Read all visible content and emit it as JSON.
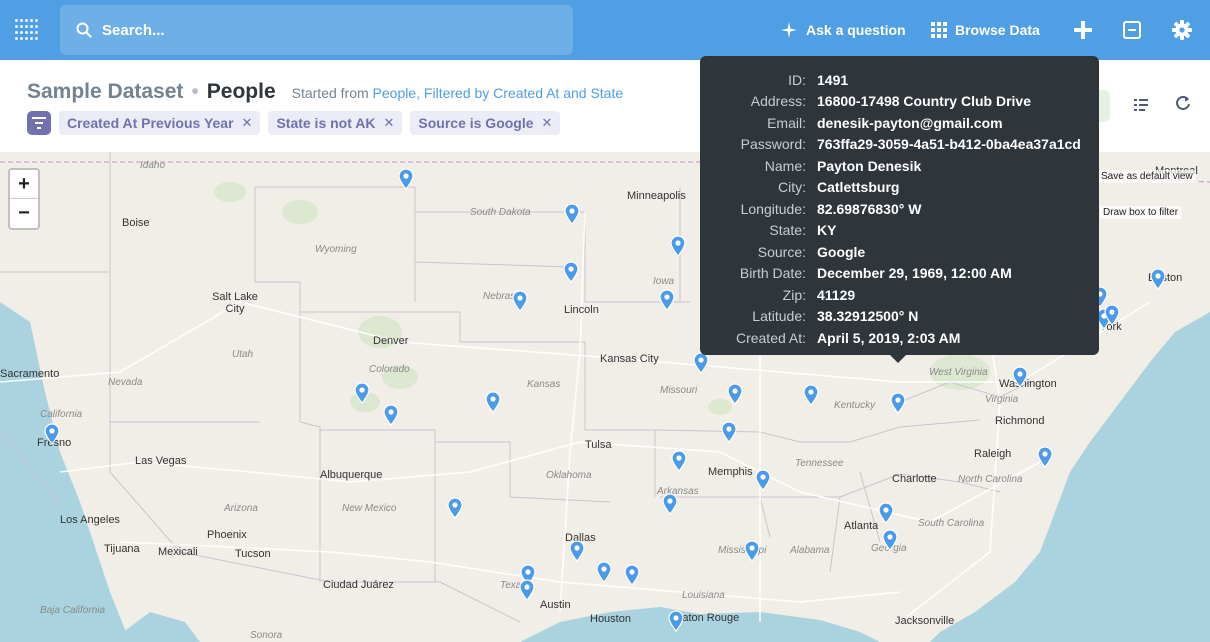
{
  "nav": {
    "search_placeholder": "Search...",
    "ask_label": "Ask a question",
    "browse_label": "Browse Data",
    "brand_color": "#509ee3"
  },
  "header": {
    "database": "Sample Dataset",
    "separator": "•",
    "table": "People",
    "started_from_prefix": "Started from",
    "started_from_link": "People, Filtered by Created At and State",
    "filters": [
      {
        "label": "Created At Previous Year"
      },
      {
        "label": "State is not AK"
      },
      {
        "label": "Source is Google"
      }
    ],
    "filter_remove_glyph": "✕"
  },
  "map": {
    "zoom_in": "+",
    "zoom_out": "−",
    "save_default_view": "Save as default view",
    "draw_box_to_filter": "Draw box to filter",
    "state_labels": [
      "Idaho",
      "South Dakota",
      "Wyoming",
      "Nebraska",
      "Utah",
      "Colorado",
      "Nevada",
      "California",
      "Kansas",
      "Missouri",
      "Arizona",
      "New Mexico",
      "Oklahoma",
      "Arkansas",
      "Texas",
      "Tennessee",
      "Kentucky",
      "West Virginia",
      "Virginia",
      "North Carolina",
      "South Carolina",
      "Georgia",
      "Alabama",
      "Mississippi",
      "Louisiana",
      "Baja California",
      "Sonora",
      "Iowa"
    ],
    "city_labels": [
      "Boise",
      "Minneapolis",
      "Salt Lake City",
      "Lincoln",
      "Denver",
      "Kansas City",
      "Sacramento",
      "Fresno",
      "Las Vegas",
      "Tulsa",
      "Memphis",
      "Albuquerque",
      "Los Angeles",
      "Phoenix",
      "Tijuana",
      "Mexicali",
      "Tucson",
      "Dallas",
      "Ciudad Juárez",
      "Austin",
      "Houston",
      "Baton Rouge",
      "Jacksonville",
      "Atlanta",
      "Charlotte",
      "Raleigh",
      "Richmond",
      "Washington",
      "Boston",
      "Montreal",
      "York"
    ]
  },
  "tooltip": {
    "rows": [
      {
        "key": "ID:",
        "value": "1491"
      },
      {
        "key": "Address:",
        "value": "16800-17498 Country Club Drive"
      },
      {
        "key": "Email:",
        "value": "denesik-payton@gmail.com"
      },
      {
        "key": "Password:",
        "value": "763ffa29-3059-4a51-b412-0ba4ea37a1cd"
      },
      {
        "key": "Name:",
        "value": "Payton Denesik"
      },
      {
        "key": "City:",
        "value": "Catlettsburg"
      },
      {
        "key": "Longitude:",
        "value": "82.69876830° W"
      },
      {
        "key": "State:",
        "value": "KY"
      },
      {
        "key": "Source:",
        "value": "Google"
      },
      {
        "key": "Birth Date:",
        "value": "December 29, 1969, 12:00 AM"
      },
      {
        "key": "Zip:",
        "value": "41129"
      },
      {
        "key": "Latitude:",
        "value": "38.32912500° N"
      },
      {
        "key": "Created At:",
        "value": "April 5, 2019, 2:03 AM"
      }
    ]
  }
}
